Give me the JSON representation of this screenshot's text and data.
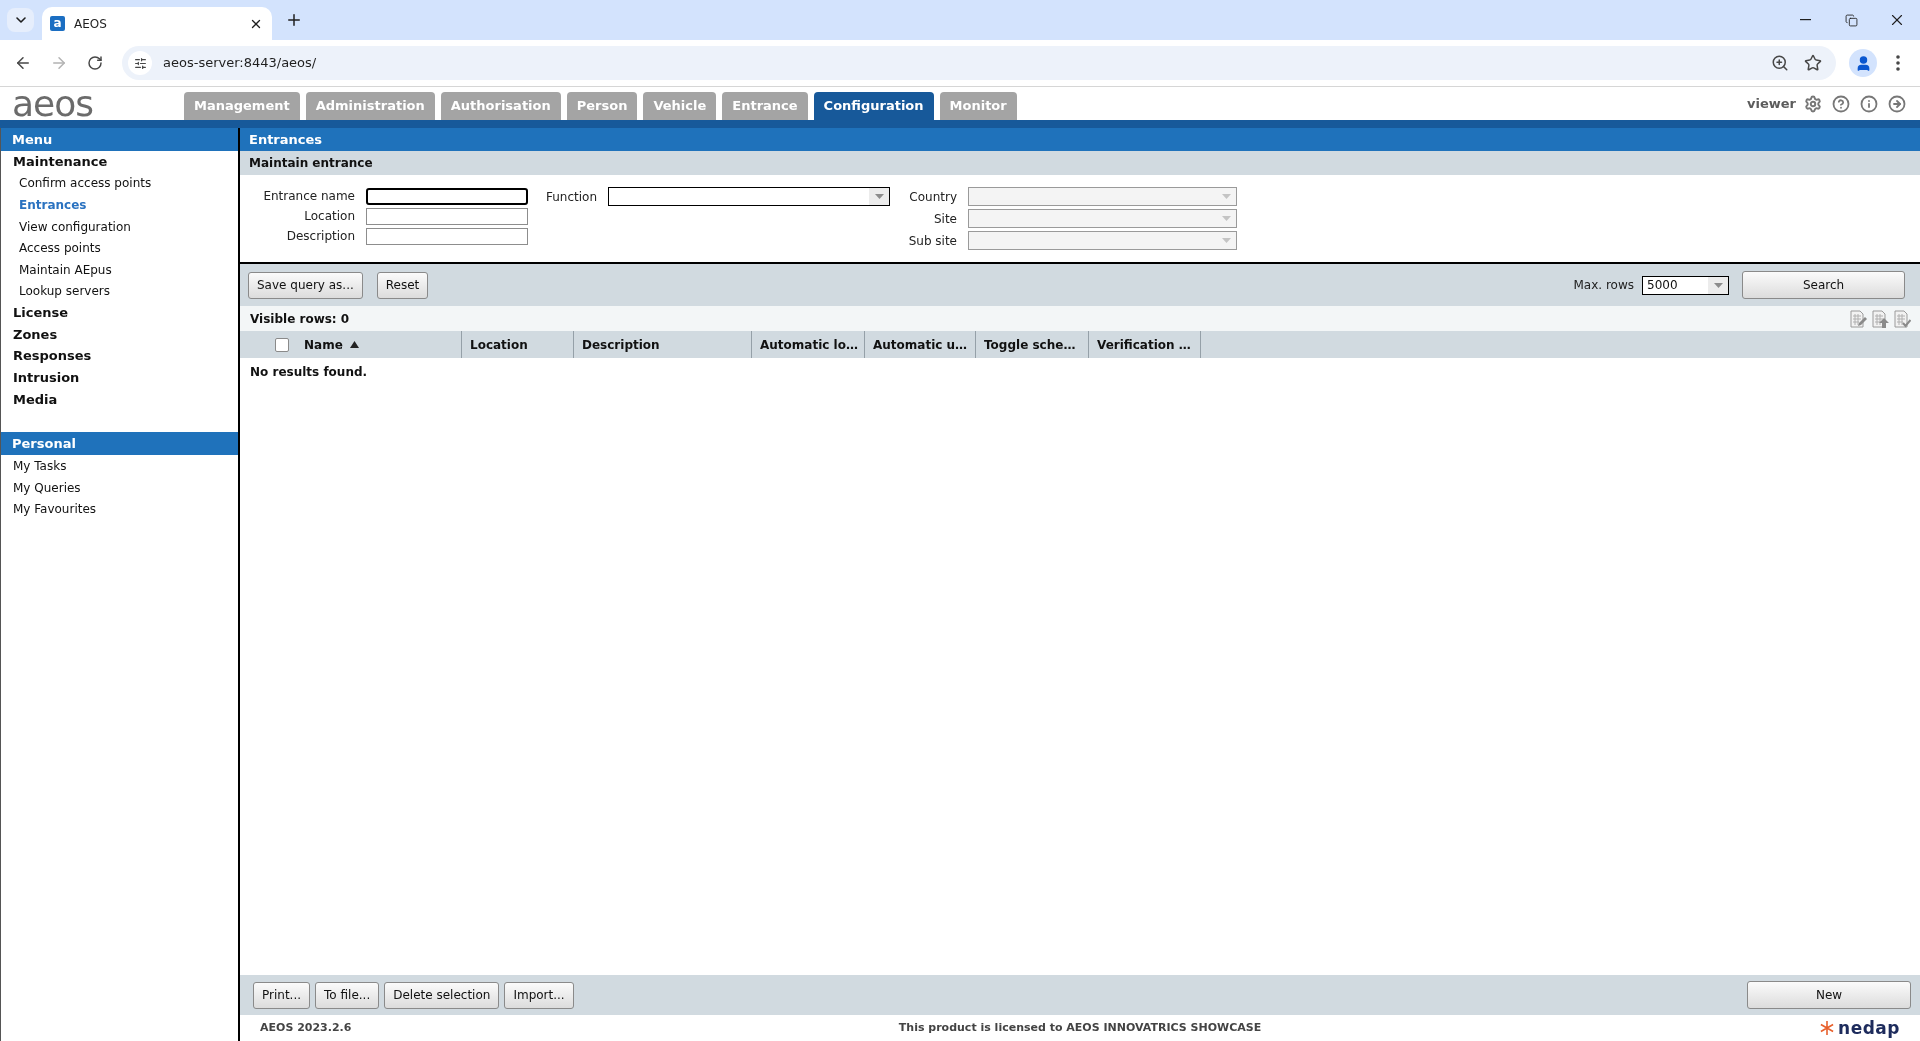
{
  "browser": {
    "favicon": "a",
    "tab_title": "AEOS",
    "url": "aeos-server:8443/aeos/"
  },
  "header": {
    "logo": "aeos",
    "tabs": [
      {
        "label": "Management",
        "selected": false
      },
      {
        "label": "Administration",
        "selected": false
      },
      {
        "label": "Authorisation",
        "selected": false
      },
      {
        "label": "Person",
        "selected": false
      },
      {
        "label": "Vehicle",
        "selected": false
      },
      {
        "label": "Entrance",
        "selected": false
      },
      {
        "label": "Configuration",
        "selected": true
      },
      {
        "label": "Monitor",
        "selected": false
      }
    ],
    "user": "viewer"
  },
  "sidebar": {
    "sections": [
      {
        "title": "Menu",
        "items": [
          {
            "label": "Maintenance",
            "kind": "group",
            "selected": false
          },
          {
            "label": "Confirm access points",
            "kind": "item",
            "selected": false
          },
          {
            "label": "Entrances",
            "kind": "item",
            "selected": true
          },
          {
            "label": "View configuration",
            "kind": "item",
            "selected": false
          },
          {
            "label": "Access points",
            "kind": "item",
            "selected": false
          },
          {
            "label": "Maintain AEpus",
            "kind": "item",
            "selected": false
          },
          {
            "label": "Lookup servers",
            "kind": "item",
            "selected": false
          },
          {
            "label": "License",
            "kind": "group",
            "selected": false
          },
          {
            "label": "Zones",
            "kind": "group",
            "selected": false
          },
          {
            "label": "Responses",
            "kind": "group",
            "selected": false
          },
          {
            "label": "Intrusion",
            "kind": "group",
            "selected": false
          },
          {
            "label": "Media",
            "kind": "group",
            "selected": false
          }
        ]
      },
      {
        "title": "Personal",
        "items": [
          {
            "label": "My Tasks",
            "kind": "link",
            "selected": false
          },
          {
            "label": "My Queries",
            "kind": "link",
            "selected": false
          },
          {
            "label": "My Favourites",
            "kind": "link",
            "selected": false
          }
        ]
      }
    ]
  },
  "panel": {
    "title": "Entrances",
    "subtitle": "Maintain entrance",
    "form": {
      "columns": [
        {
          "fields": [
            {
              "label": "Entrance name",
              "kind": "text",
              "focused": true
            },
            {
              "label": "Location",
              "kind": "text",
              "focused": false
            },
            {
              "label": "Description",
              "kind": "text",
              "focused": false
            }
          ]
        },
        {
          "fields": [
            {
              "label": "Function",
              "kind": "select",
              "disabled": false
            }
          ]
        },
        {
          "fields": [
            {
              "label": "Country",
              "kind": "select",
              "disabled": true
            },
            {
              "label": "Site",
              "kind": "select",
              "disabled": true
            },
            {
              "label": "Sub site",
              "kind": "select",
              "disabled": true
            }
          ]
        }
      ]
    }
  },
  "toolbar": {
    "buttons": [
      "Save query as...",
      "Reset"
    ],
    "max_rows_label": "Max. rows",
    "max_rows_value": "5000",
    "search_button": "Search"
  },
  "results": {
    "visible_rows": "Visible rows: 0",
    "select_all_checked": false,
    "columns": [
      {
        "label": "Name",
        "sorted": true
      },
      {
        "label": "Location",
        "sorted": false
      },
      {
        "label": "Description",
        "sorted": false
      },
      {
        "label": "Automatic lo…",
        "sorted": false
      },
      {
        "label": "Automatic u…",
        "sorted": false
      },
      {
        "label": "Toggle sche…",
        "sorted": false
      },
      {
        "label": "Verification …",
        "sorted": false
      }
    ],
    "empty_message": "No results found."
  },
  "actions": {
    "buttons": [
      "Print...",
      "To file...",
      "Delete selection",
      "Import..."
    ],
    "new_button": "New"
  },
  "footer": {
    "version": "AEOS 2023.2.6",
    "license": "This product is licensed to AEOS INNOVATRICS SHOWCASE",
    "brand": "nedap"
  }
}
